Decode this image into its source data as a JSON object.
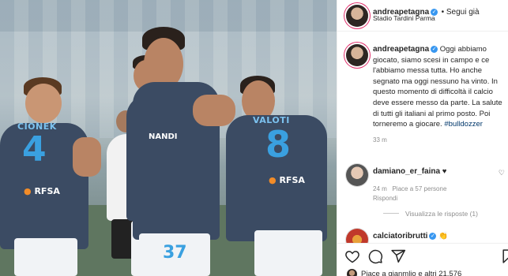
{
  "post": {
    "username": "andreapetagna",
    "follow_label": "• Segui già",
    "location": "Stadio Tardini Parma",
    "caption_user": "andreapetagna",
    "caption_text": "Oggi abbiamo giocato, siamo scesi in campo e ce l'abbiamo messa tutta. Ho anche segnato ma oggi nessuno ha vinto. In questo momento di difficoltà il calcio deve essere messo da parte. La salute di tutti gli italiani al primo posto. Poi torneremo a giocare.",
    "hashtag": "#bulldozzer",
    "caption_time": "33 m"
  },
  "comments": [
    {
      "user": "damiano_er_faina",
      "text": "♥",
      "time": "24 m",
      "likes": "Piace a 57 persone",
      "reply": "Rispondi",
      "view_replies": "Visualizza le risposte (1)"
    },
    {
      "user": "calciatoribrutti",
      "text": "👏"
    }
  ],
  "likes_text": "Piace a gianmlio e altri 21.576",
  "photo": {
    "players": [
      {
        "name": "CIONEK",
        "number": "4"
      },
      {
        "name": "",
        "number": "37"
      },
      {
        "name": "VALOTI",
        "number": "8"
      }
    ],
    "sponsor_main": "RFSA",
    "sponsor_accent": "●",
    "sponsor_chest": "NANDI"
  },
  "colors": {
    "accent_blue": "#3897f0",
    "story_ring": "#e1306c",
    "kit_navy": "#3b4b63",
    "kit_number": "#3aa0e0"
  },
  "icons": [
    "heart-icon",
    "comment-icon",
    "share-icon",
    "bookmark-icon",
    "verified-icon",
    "more-icon"
  ]
}
